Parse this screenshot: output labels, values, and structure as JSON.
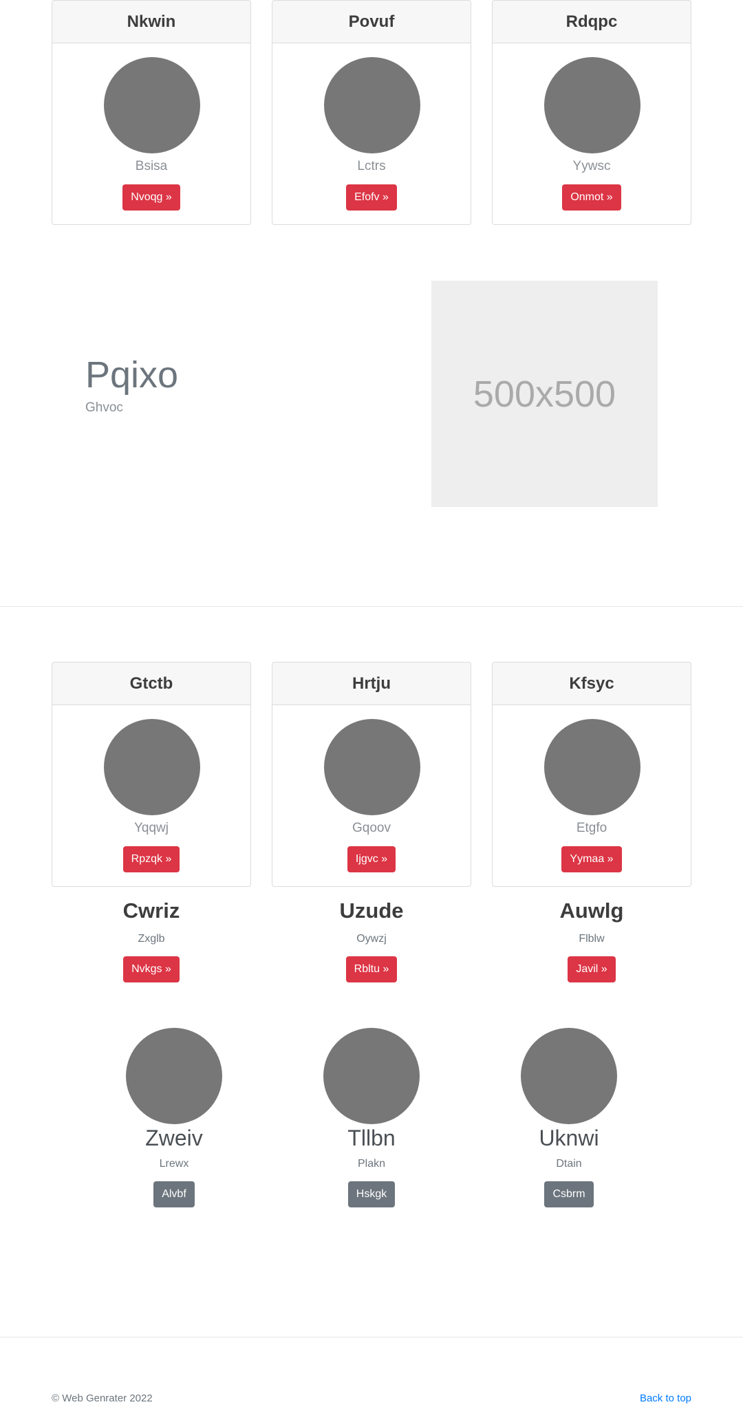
{
  "cards_top": [
    {
      "title": "Nkwin",
      "subtitle": "Bsisa",
      "button": "Nvoqg »"
    },
    {
      "title": "Povuf",
      "subtitle": "Lctrs",
      "button": "Efofv »"
    },
    {
      "title": "Rdqpc",
      "subtitle": "Yywsc",
      "button": "Onmot »"
    }
  ],
  "feature": {
    "title": "Pqixo",
    "subtitle": "Ghvoc",
    "placeholder_text": "500x500"
  },
  "cards_mid": [
    {
      "title": "Gtctb",
      "subtitle": "Yqqwj",
      "button": "Rpzqk »"
    },
    {
      "title": "Hrtju",
      "subtitle": "Gqoov",
      "button": "Ijgvc »"
    },
    {
      "title": "Kfsyc",
      "subtitle": "Etgfo",
      "button": "Yymaa »"
    }
  ],
  "text_cols": [
    {
      "title": "Cwriz",
      "subtitle": "Zxglb",
      "button": "Nvkgs »"
    },
    {
      "title": "Uzude",
      "subtitle": "Oywzj",
      "button": "Rbltu »"
    },
    {
      "title": "Auwlg",
      "subtitle": "Flblw",
      "button": "Javil »"
    }
  ],
  "media_cols": [
    {
      "title": "Zweiv",
      "subtitle": "Lrewx",
      "button": "Alvbf"
    },
    {
      "title": "Tllbn",
      "subtitle": "Plakn",
      "button": "Hskgk"
    },
    {
      "title": "Uknwi",
      "subtitle": "Dtain",
      "button": "Csbrm"
    }
  ],
  "footer": {
    "copyright": "© Web Genrater 2022",
    "back_to_top": "Back to top"
  },
  "colors": {
    "accent_red": "#dc3545",
    "secondary_gray": "#6c757d",
    "link_blue": "#007bff",
    "avatar_gray": "#777777"
  }
}
